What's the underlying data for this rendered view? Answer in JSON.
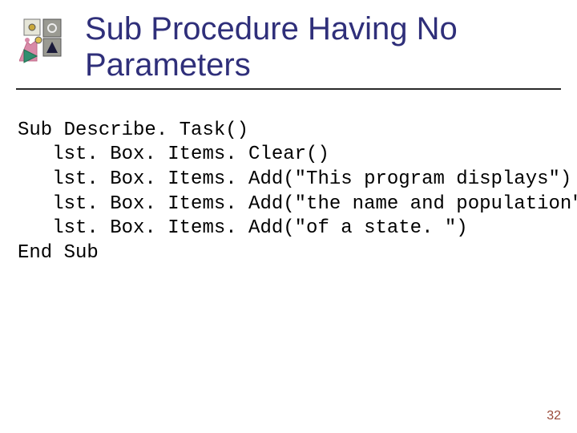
{
  "title": "Sub Procedure Having No Parameters",
  "code": {
    "l1": "Sub Describe. Task()",
    "l2": "   lst. Box. Items. Clear()",
    "l3": "   lst. Box. Items. Add(\"This program displays\")",
    "l4": "   lst. Box. Items. Add(\"the name and population\")",
    "l5": "   lst. Box. Items. Add(\"of a state. \")",
    "l6": "End Sub"
  },
  "page_number": "32"
}
